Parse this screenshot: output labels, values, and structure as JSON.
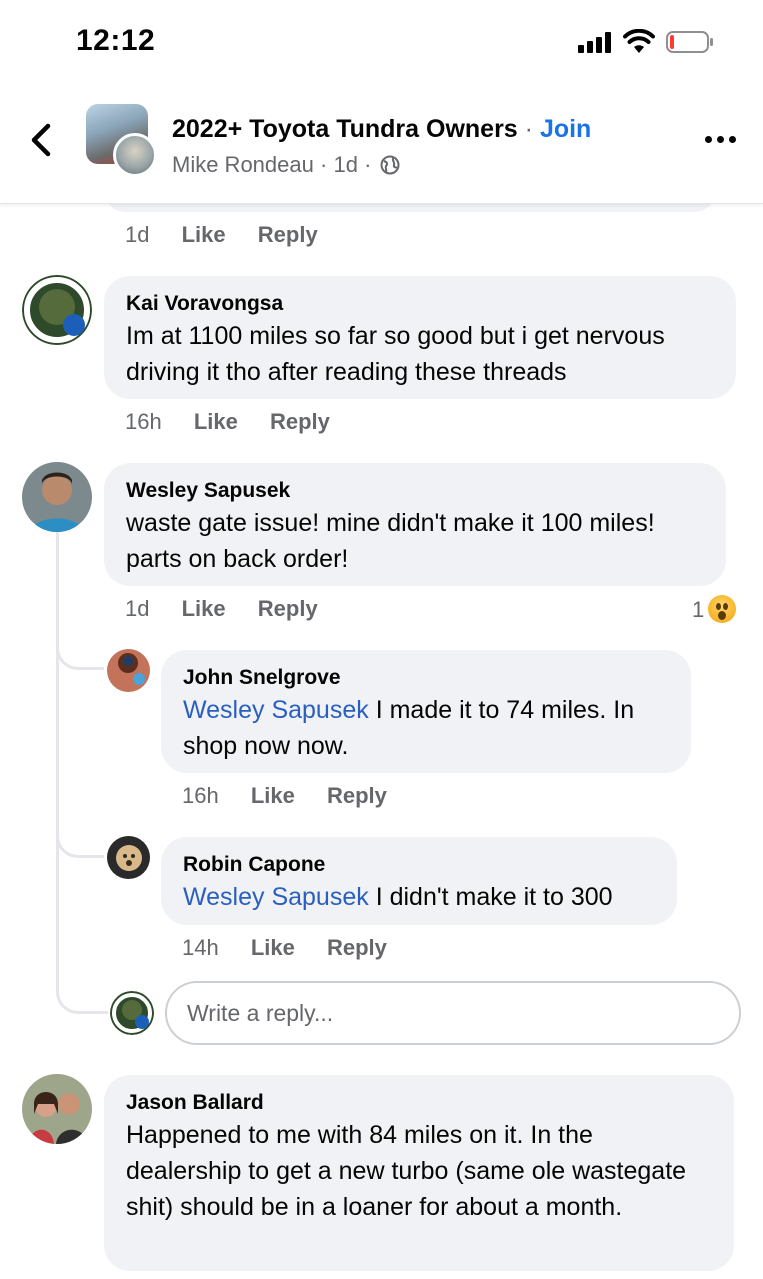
{
  "status": {
    "time": "12:12"
  },
  "header": {
    "group_name": "2022+ Toyota Tundra Owners",
    "separator": "·",
    "join_label": "Join",
    "author": "Mike Rondeau",
    "age": "1d",
    "dot": "·"
  },
  "top_meta": {
    "time": "1d",
    "like": "Like",
    "reply": "Reply"
  },
  "comments": [
    {
      "name": "Kai Voravongsa",
      "text": "Im at 1100 miles so far so good but i get nervous driving it tho after reading these threads",
      "time": "16h",
      "like": "Like",
      "reply": "Reply"
    },
    {
      "name": "Wesley Sapusek",
      "text": "waste gate issue! mine didn't make it 100 miles! parts on back order!",
      "time": "1d",
      "like": "Like",
      "reply": "Reply",
      "reaction_count": "1",
      "reaction_icon": "wow-emoji-icon"
    },
    {
      "name": "Jason Ballard",
      "text": "Happened to me with 84 miles on it. In the dealership to get a new turbo (same ole wastegate shit) should be in a loaner for about a month."
    }
  ],
  "replies": [
    {
      "name": "John Snelgrove",
      "mention": "Wesley Sapusek",
      "text": " I made it to 74 miles. In shop now now.",
      "time": "16h",
      "like": "Like",
      "reply": "Reply"
    },
    {
      "name": "Robin Capone",
      "mention": "Wesley Sapusek",
      "text": " I didn't make it to 300",
      "time": "14h",
      "like": "Like",
      "reply": "Reply"
    }
  ],
  "reply_input": {
    "placeholder": "Write a reply..."
  },
  "colors": {
    "bubble": "#f0f2f5",
    "link": "#1b74e4",
    "mention": "#2a5fbf",
    "muted": "#65676b"
  }
}
